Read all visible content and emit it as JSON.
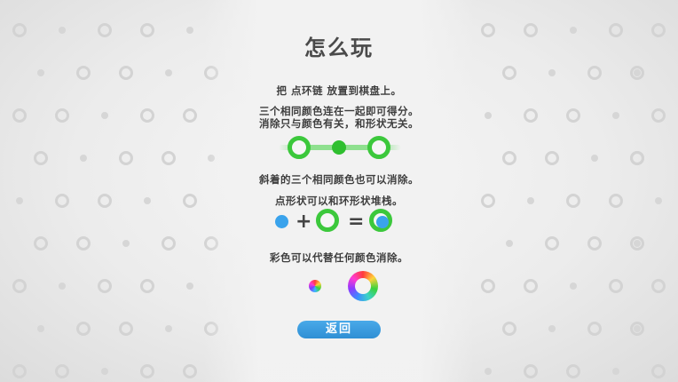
{
  "screen": "how-to-play",
  "title": "怎么玩",
  "instructions": {
    "place": "把 点环链 放置到棋盘上。",
    "match_line1": "三个相同颜色连在一起即可得分。",
    "match_line2": "消除只与颜色有关，和形状无关。",
    "diagonal": "斜着的三个相同颜色也可以消除。",
    "stack": "点形状可以和环形状堆栈。",
    "rainbow": "彩色可以代替任何颜色消除。"
  },
  "symbols": {
    "plus": "+",
    "equals": "="
  },
  "colors": {
    "green": "#3cc83c",
    "blue": "#3aa3ec",
    "button": "#3a9be0",
    "title": "#4a4a4a"
  },
  "back_button": {
    "label": "返回"
  }
}
